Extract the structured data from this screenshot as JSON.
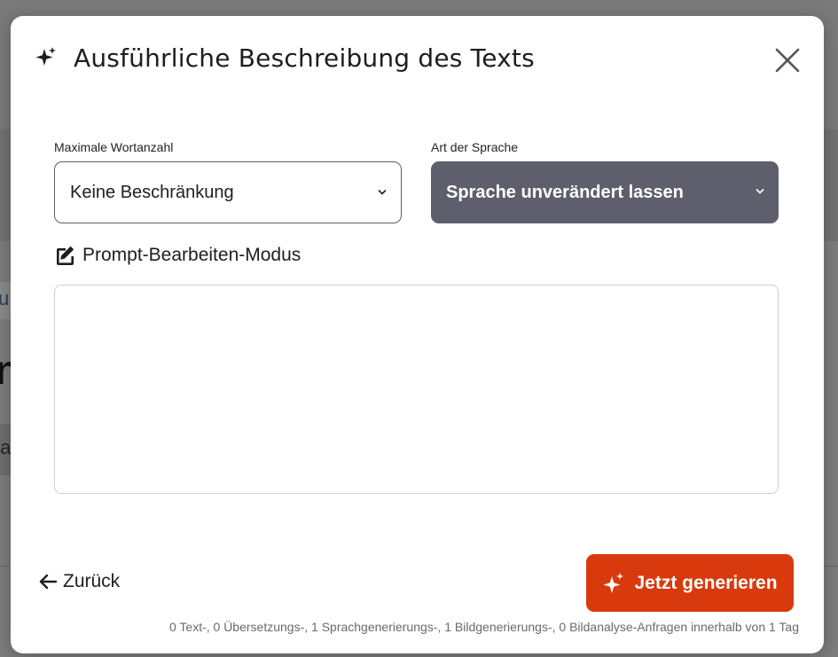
{
  "background": {
    "fragments": [
      "u",
      "n",
      "fa"
    ]
  },
  "modal": {
    "title": "Ausführliche Beschreibung des Texts",
    "title_icon": "sparkles-icon",
    "close_icon": "close-icon"
  },
  "form": {
    "max_words": {
      "label": "Maximale Wortanzahl",
      "selected": "Keine Beschränkung"
    },
    "language_style": {
      "label": "Art der Sprache",
      "selected": "Sprache unverändert lassen"
    },
    "prompt_mode": {
      "label": "Prompt-Bearbeiten-Modus",
      "icon": "edit-icon"
    },
    "prompt_text": {
      "value": "",
      "placeholder": ""
    }
  },
  "footer": {
    "back_label": "Zurück",
    "generate_label": "Jetzt generieren",
    "quota_text": "0 Text-, 0 Übersetzungs-, 1 Sprachgenerierungs-, 1 Bildgenerierungs-, 0 Bildanalyse-Anfragen innerhalb von 1 Tag"
  },
  "colors": {
    "accent": "#d83a0d",
    "dark_select": "#5e5e6d",
    "overlay": "#7d7d7d"
  }
}
